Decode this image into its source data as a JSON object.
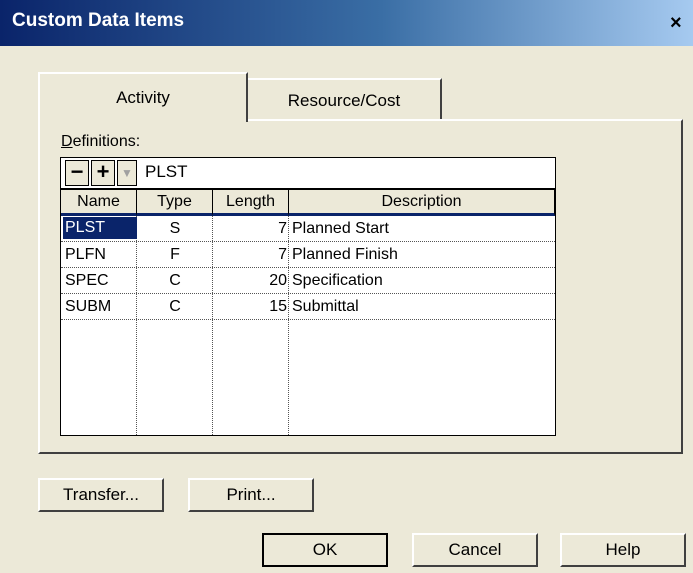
{
  "window": {
    "title": "Custom Data Items",
    "close_glyph": "×"
  },
  "tabs": [
    {
      "label": "Activity",
      "active": true
    },
    {
      "label": "Resource/Cost",
      "active": false
    }
  ],
  "definitions": {
    "label_underlined": "D",
    "label_rest": "efinitions:",
    "toolbar": {
      "minus": "−",
      "plus": "+",
      "dropdown": "▼"
    },
    "current_value": "PLST"
  },
  "table": {
    "headers": [
      "Name",
      "Type",
      "Length",
      "Description"
    ],
    "rows": [
      {
        "name": "PLST",
        "type": "S",
        "length": "7",
        "description": "Planned Start",
        "selected": true
      },
      {
        "name": "PLFN",
        "type": "F",
        "length": "7",
        "description": "Planned Finish"
      },
      {
        "name": "SPEC",
        "type": "C",
        "length": "20",
        "description": "Specification"
      },
      {
        "name": "SUBM",
        "type": "C",
        "length": "15",
        "description": "Submittal"
      }
    ]
  },
  "buttons": {
    "transfer": "Transfer...",
    "print": "Print...",
    "ok": "OK",
    "cancel": "Cancel",
    "help": "Help"
  },
  "colors": {
    "title_bar": "#0a246a",
    "selection": "#0a246a",
    "dialog_bg": "#ece9d8"
  }
}
